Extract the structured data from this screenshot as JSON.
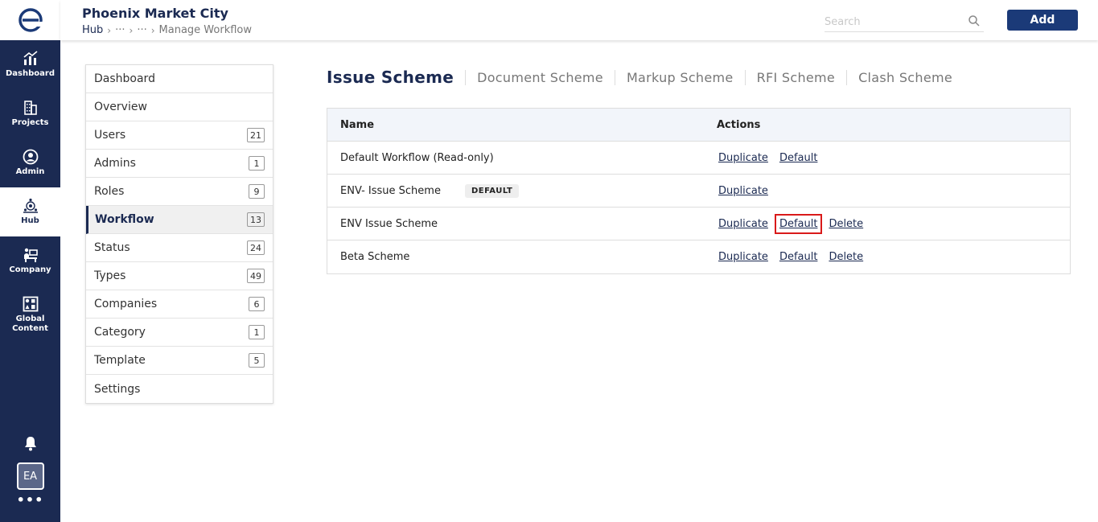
{
  "rail": {
    "items": [
      {
        "label": "Dashboard",
        "icon": "chart-icon"
      },
      {
        "label": "Projects",
        "icon": "building-icon"
      },
      {
        "label": "Admin",
        "icon": "admin-icon"
      },
      {
        "label": "Hub",
        "icon": "hub-icon"
      },
      {
        "label": "Company",
        "icon": "company-icon"
      },
      {
        "label": "Global Content",
        "icon": "global-content-icon"
      }
    ],
    "avatar": "EA",
    "more": "•••"
  },
  "header": {
    "title": "Phoenix Market City",
    "breadcrumb": [
      "Hub",
      "···",
      "···",
      "Manage Workflow"
    ],
    "search_placeholder": "Search",
    "add_label": "Add"
  },
  "menu": {
    "items": [
      {
        "label": "Dashboard",
        "count": null
      },
      {
        "label": "Overview",
        "count": null
      },
      {
        "label": "Users",
        "count": "21"
      },
      {
        "label": "Admins",
        "count": "1"
      },
      {
        "label": "Roles",
        "count": "9"
      },
      {
        "label": "Workflow",
        "count": "13"
      },
      {
        "label": "Status",
        "count": "24"
      },
      {
        "label": "Types",
        "count": "49"
      },
      {
        "label": "Companies",
        "count": "6"
      },
      {
        "label": "Category",
        "count": "1"
      },
      {
        "label": "Template",
        "count": "5"
      },
      {
        "label": "Settings",
        "count": null
      }
    ]
  },
  "tabs": [
    "Issue Scheme",
    "Document Scheme",
    "Markup Scheme",
    "RFI Scheme",
    "Clash Scheme"
  ],
  "table": {
    "headers": {
      "name": "Name",
      "actions": "Actions"
    },
    "rows": [
      {
        "name": "Default Workflow (Read-only)",
        "chip": "",
        "actions": [
          "Duplicate",
          "Default"
        ]
      },
      {
        "name": "ENV- Issue Scheme",
        "chip": "DEFAULT",
        "actions": [
          "Duplicate"
        ]
      },
      {
        "name": "ENV Issue Scheme",
        "chip": "",
        "actions": [
          "Duplicate",
          "Default",
          "Delete"
        ]
      },
      {
        "name": "Beta Scheme",
        "chip": "",
        "actions": [
          "Duplicate",
          "Default",
          "Delete"
        ]
      }
    ]
  }
}
